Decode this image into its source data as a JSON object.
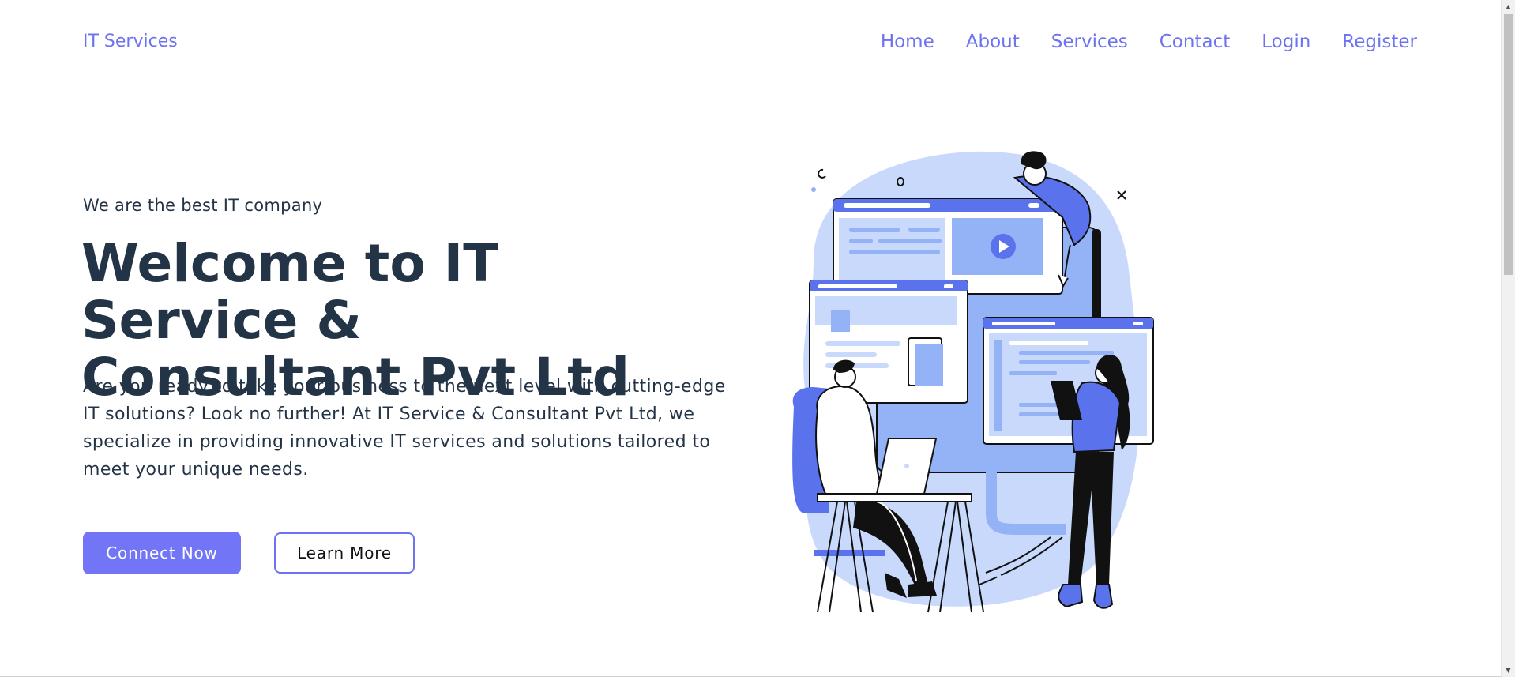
{
  "header": {
    "brand": "IT Services",
    "nav": [
      "Home",
      "About",
      "Services",
      "Contact",
      "Login",
      "Register"
    ]
  },
  "hero": {
    "tagline": "We are the best IT company",
    "headline_line1": "Welcome to IT Service &",
    "headline_line2": "Consultant Pvt Ltd",
    "description": "Are you ready to take your business to the next level with cutting-edge IT solutions? Look no further! At IT Service & Consultant Pvt Ltd, we specialize in providing innovative IT services and solutions tailored to meet your unique needs.",
    "primary_button": "Connect Now",
    "secondary_button": "Learn More"
  },
  "colors": {
    "accent": "#6c72f0",
    "heading": "#243447",
    "illustration_light": "#c9d9fb",
    "illustration_mid": "#94b2f6",
    "illustration_dark": "#5a73ec"
  },
  "icons": {
    "play": "play-icon",
    "scroll_up": "chevron-up-icon",
    "scroll_down": "chevron-down-icon"
  }
}
